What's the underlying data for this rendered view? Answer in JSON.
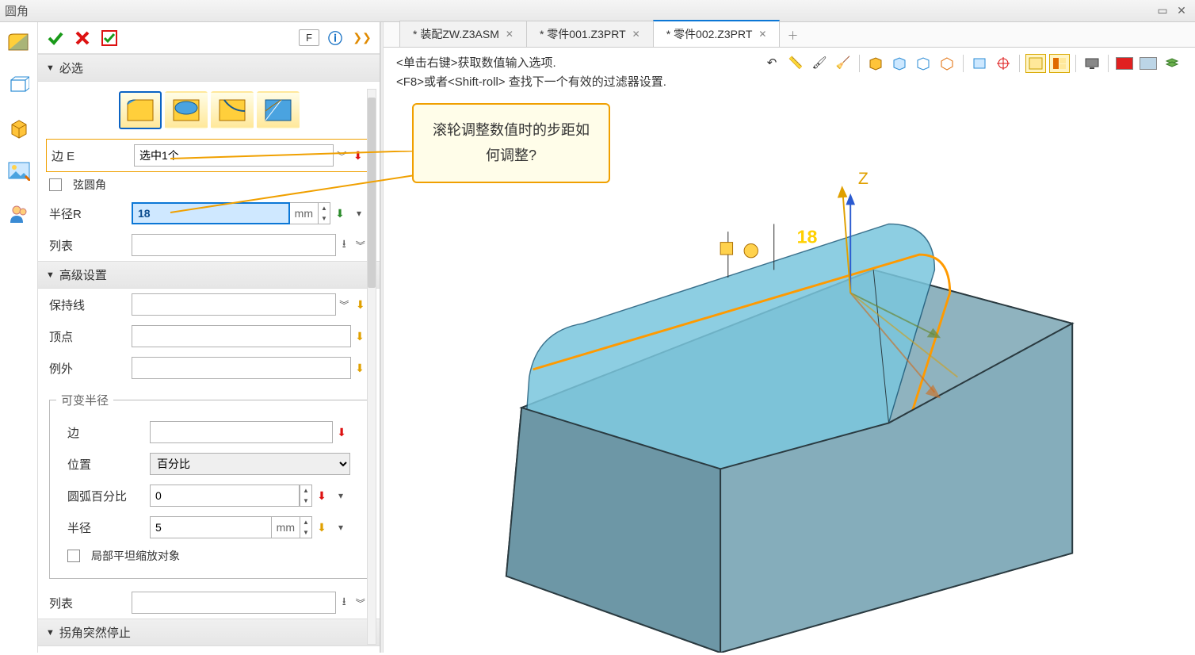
{
  "title": "圆角",
  "toolbar": {
    "f_key": "F"
  },
  "sections": {
    "required": "必选",
    "advanced": "高级设置",
    "corner_stop": "拐角突然停止"
  },
  "fields": {
    "edge_e_label": "边 E",
    "edge_e_value": "选中1个",
    "chord_fillet": "弦圆角",
    "radius_r_label": "半径R",
    "radius_r_value": "18",
    "radius_r_unit": "mm",
    "list_label": "列表",
    "keep_line": "保持线",
    "vertex": "顶点",
    "exception": "例外"
  },
  "var_radius": {
    "legend": "可变半径",
    "edge": "边",
    "position": "位置",
    "position_value": "百分比",
    "arc_pct": "圆弧百分比",
    "arc_pct_value": "0",
    "radius": "半径",
    "radius_value": "5",
    "radius_unit": "mm",
    "local_flat_scale": "局部平坦缩放对象",
    "list": "列表"
  },
  "tabs": [
    {
      "label": "* 装配ZW.Z3ASM",
      "active": false
    },
    {
      "label": "* 零件001.Z3PRT",
      "active": false
    },
    {
      "label": "* 零件002.Z3PRT",
      "active": true
    }
  ],
  "hints": {
    "line1": "<单击右键>获取数值输入选项.",
    "line2": "<F8>或者<Shift-roll> 查找下一个有效的过滤器设置."
  },
  "callout": "滚轮调整数值时的步距如何调整?",
  "viewport": {
    "axis_label_z": "Z",
    "dim_value": "18"
  }
}
